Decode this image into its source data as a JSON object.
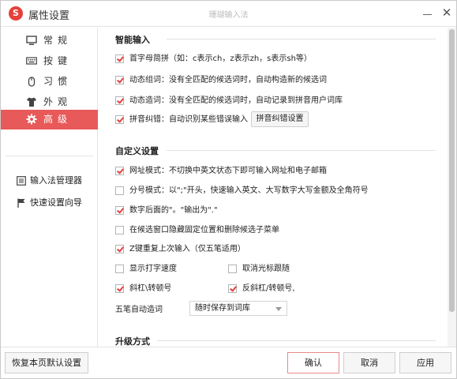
{
  "window": {
    "logo": "S",
    "title": "属性设置",
    "center_title": "珊瑚输入法",
    "close_glyph": "✕"
  },
  "sidebar": {
    "items": [
      {
        "label": "常规",
        "icon": "monitor-icon"
      },
      {
        "label": "按键",
        "icon": "keyboard-icon"
      },
      {
        "label": "习惯",
        "icon": "mouse-icon"
      },
      {
        "label": "外观",
        "icon": "shirt-icon"
      },
      {
        "label": "高级",
        "icon": "gear-icon",
        "active": true
      }
    ],
    "tools": [
      {
        "label": "输入法管理器",
        "icon": "list-icon"
      },
      {
        "label": "快速设置向导",
        "icon": "flag-icon"
      }
    ]
  },
  "smart_input": {
    "title": "智能输入",
    "options": [
      {
        "label": "首字母简拼（如：c表示ch，z表示zh，s表示sh等）",
        "checked": true
      },
      {
        "label": "动态组词：没有全匹配的候选词时，自动构造新的候选词",
        "checked": true
      },
      {
        "label": "动态造词：没有全匹配的候选词时，自动记录到拼音用户词库",
        "checked": true
      },
      {
        "label": "拼音纠错：自动识别某些错误输入",
        "checked": true
      }
    ],
    "correction_button": "拼音纠错设置"
  },
  "custom_settings": {
    "title": "自定义设置",
    "options": [
      {
        "label": "网址模式：不切换中英文状态下即可输入网址和电子邮箱",
        "checked": true
      },
      {
        "label": "分号模式：以\";\"开头，快速输入英文、大写数字大写金额及全角符号",
        "checked": false
      },
      {
        "label": "数字后面的\"。\"输出为\".\"",
        "checked": true
      },
      {
        "label": "在候选窗口隐藏固定位置和删除候选子菜单",
        "checked": false
      },
      {
        "label": "Z键重复上次输入（仅五笔适用）",
        "checked": true
      }
    ],
    "pair_row1": [
      {
        "label": "显示打字速度",
        "checked": false
      },
      {
        "label": "取消光标跟随",
        "checked": false
      }
    ],
    "pair_row2": [
      {
        "label": "斜杠\\转顿号",
        "checked": true
      },
      {
        "label": "反斜杠/转顿号,",
        "checked": true
      }
    ],
    "wubi_label": "五笔自动造词",
    "wubi_value": "随时保存到词库"
  },
  "upgrade": {
    "title": "升级方式"
  },
  "footer": {
    "restore": "恢复本页默认设置",
    "ok": "确认",
    "cancel": "取消",
    "apply": "应用"
  },
  "colors": {
    "accent": "#e85959",
    "check": "#e04040",
    "logo": "#e5413a"
  }
}
